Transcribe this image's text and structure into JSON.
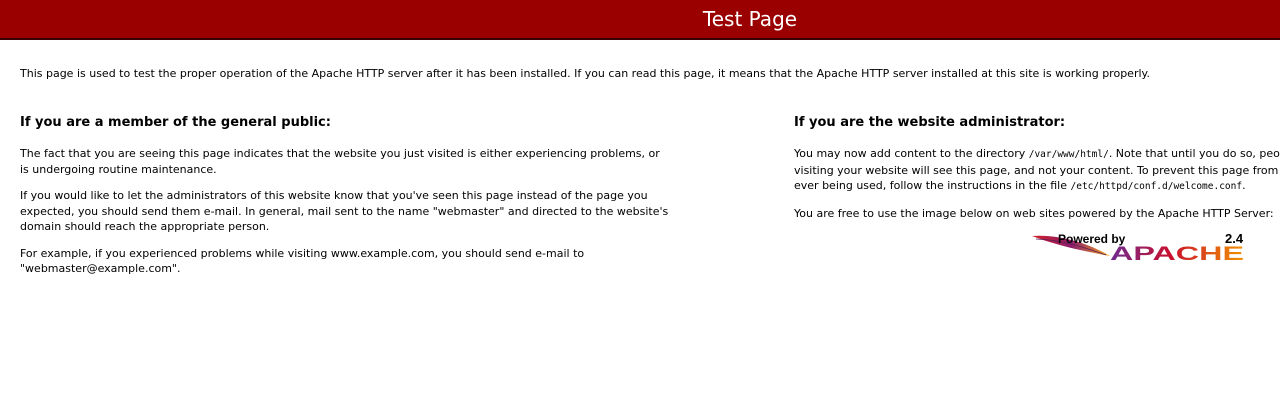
{
  "header": {
    "title": "Test Page"
  },
  "intro": {
    "text": "This page is used to test the proper operation of the Apache HTTP server after it has been installed. If you can read this page, it means that the Apache HTTP server installed at this site is working properly."
  },
  "public_section": {
    "heading": "If you are a member of the general public:",
    "p1": "The fact that you are seeing this page indicates that the website you just visited is either experiencing problems, or is undergoing routine maintenance.",
    "p2": "If you would like to let the administrators of this website know that you've seen this page instead of the page you expected, you should send them e-mail. In general, mail sent to the name \"webmaster\" and directed to the website's domain should reach the appropriate person.",
    "p3": "For example, if you experienced problems while visiting www.example.com, you should send e-mail to \"webmaster@example.com\"."
  },
  "admin_section": {
    "heading": "If you are the website administrator:",
    "p1_pre": "You may now add content to the directory ",
    "p1_dir": "/var/www/html/",
    "p1_mid": ". Note that until you do so, people visiting your website will see this page, and not your content. To prevent this page from ever being used, follow the instructions in the file ",
    "p1_file": "/etc/httpd/conf.d/welcome.conf",
    "p1_post": ".",
    "p2": "You are free to use the image below on web sites powered by the Apache HTTP Server:"
  },
  "badge": {
    "powered_by": "Powered by",
    "version": "2.4",
    "brand": "APACHE",
    "icon": "apache-feather-icon"
  }
}
